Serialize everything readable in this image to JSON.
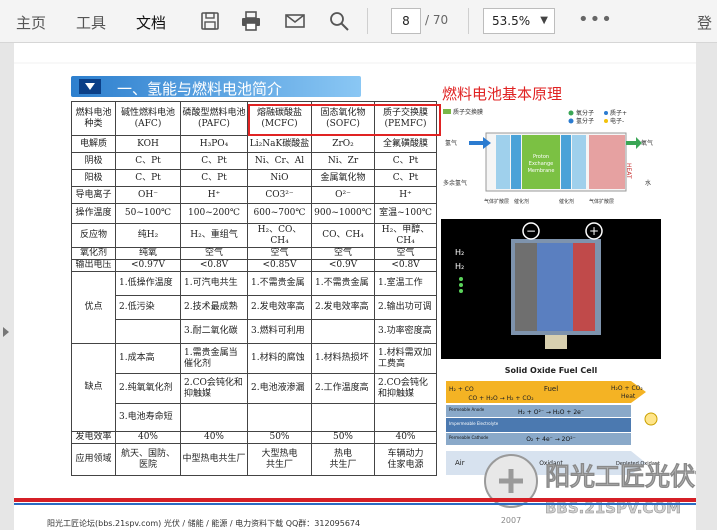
{
  "toolbar": {
    "menus": [
      "主页",
      "工具",
      "文档"
    ],
    "active_menu": "文档",
    "page_current": "8",
    "page_total": "/ 70",
    "zoom": "53.5%",
    "login": "登"
  },
  "doc": {
    "section_title": "一、氢能与燃料电池简介",
    "side_title": "燃料电池基本原理",
    "table": {
      "headers": [
        [
          "燃料电池",
          "种类"
        ],
        [
          "碱性燃料电池",
          "(AFC)"
        ],
        [
          "磷酸型燃料电池",
          "(PAFC)"
        ],
        [
          "熔融碳酸盐",
          "(MCFC)"
        ],
        [
          "固态氧化物",
          "(SOFC)"
        ],
        [
          "质子交换膜",
          "(PEMFC)"
        ]
      ],
      "rows": [
        {
          "label": "电解质",
          "cells": [
            "KOH",
            "H₃PO₄",
            "Li₂NaK碳酸盐",
            "ZrO₂",
            "全氟磺酸膜"
          ]
        },
        {
          "label": "阴极",
          "cells": [
            "C、Pt",
            "C、Pt",
            "Ni、Cr、Al",
            "Ni、Zr",
            "C、Pt"
          ]
        },
        {
          "label": "阳极",
          "cells": [
            "C、Pt",
            "C、Pt",
            "NiO",
            "金属氧化物",
            "C、Pt"
          ]
        },
        {
          "label": "导电离子",
          "cells": [
            "OH⁻",
            "H⁺",
            "CO3²⁻",
            "O²⁻",
            "H⁺"
          ]
        },
        {
          "label": "操作温度",
          "cells": [
            "50~100℃",
            "100~200℃",
            "600~700℃",
            "900~1000℃",
            "室温~100℃"
          ]
        },
        {
          "label": "反应物",
          "cells": [
            "纯H₂",
            "H₂、重组气",
            "H₂、CO、CH₄",
            "CO、CH₄",
            "H₂、甲醇、CH₄"
          ]
        },
        {
          "label": "氧化剂",
          "cells": [
            "纯氧",
            "空气",
            "空气",
            "空气",
            "空气"
          ]
        },
        {
          "label": "输出电压",
          "cells": [
            "<0.97V",
            "<0.8V",
            "<0.85V",
            "<0.9V",
            "<0.8V"
          ]
        }
      ],
      "advantages_label": "优点",
      "advantages": [
        [
          "1.低操作温度",
          "1.可汽电共生",
          "1.不需贵金属",
          "1.不需贵金属",
          "1.室温工作"
        ],
        [
          "2.低污染",
          "2.技术最成熟",
          "2.发电效率高",
          "2.发电效率高",
          "2.输出功可调"
        ],
        [
          "",
          "3.耐二氧化碳",
          "3.燃料可利用",
          "",
          "3.功率密度高"
        ]
      ],
      "disadvantages_label": "缺点",
      "disadvantages": [
        [
          "1.成本高",
          "1.需贵金属当催化剂",
          "1.材料的腐蚀",
          "1.材料热损坏",
          "1.材料需双加工费高"
        ],
        [
          "2.纯氧氧化剂",
          "2.CO会钝化和抑触媒",
          "2.电池液渗漏",
          "2.工作温度高",
          "2.CO会钝化和抑触媒"
        ],
        [
          "3.电池寿命短",
          "",
          "",
          "",
          ""
        ]
      ],
      "efficiency": {
        "label": "发电效率",
        "cells": [
          "40%",
          "40%",
          "50%",
          "50%",
          "40%"
        ]
      },
      "applications": {
        "label": "应用领域",
        "cells": [
          [
            "航天、国防、",
            "医院"
          ],
          [
            "中型热电共生厂"
          ],
          [
            "大型热电",
            "共生厂"
          ],
          [
            "热电",
            "共生厂"
          ],
          [
            "车辆动力",
            "住家电源"
          ]
        ]
      }
    },
    "fc_diagram": {
      "legend": [
        "质子交换膜",
        "氧分子",
        "氢分子",
        "质子+",
        "电子-"
      ],
      "labels_left": [
        "氢气",
        "多余氢气"
      ],
      "labels_right": [
        "氧气",
        "水"
      ],
      "labels_bottom": [
        "气体扩散层",
        "催化剂",
        "催化剂",
        "气体扩散层"
      ],
      "center_text": [
        "Proton",
        "Exchange",
        "Membrane"
      ],
      "heat": "HEAT"
    },
    "cell_panel": {
      "minus": "−",
      "plus": "+",
      "h2_left": "H₂",
      "h2_left2": "H₂"
    },
    "sofc": {
      "title": "Solid Oxide Fuel Cell",
      "fuel": "Fuel",
      "h2co": "H₂ + CO",
      "products": "H₂O + CO₂",
      "heat": "Heat",
      "reaction_top": "CO + H₂O → H₂ + CO₂",
      "reaction_mid": "H₂ + O²⁻ → H₂O + 2e⁻",
      "reaction_bot": "O₂ + 4e⁻ → 2O²⁻",
      "layers": [
        "Permeable Anode",
        "Impermeable Electrolyte",
        "Permeable Cathode"
      ],
      "air": "Air",
      "oxidant": "Oxidant",
      "depleted": "Depleted Oxidant"
    },
    "logo": {
      "text": "阳光工匠光伏论坛",
      "url": "BBS.21SPV.COM",
      "year": "2007"
    },
    "footer": "阳光工匠论坛(bbs.21spv.com)    光伏 / 储能 / 能源 / 电力资料下载    QQ群：312095674"
  },
  "colors": {
    "accent_red": "#e02323",
    "accent_blue": "#2d7fce",
    "table_border": "#444444"
  }
}
